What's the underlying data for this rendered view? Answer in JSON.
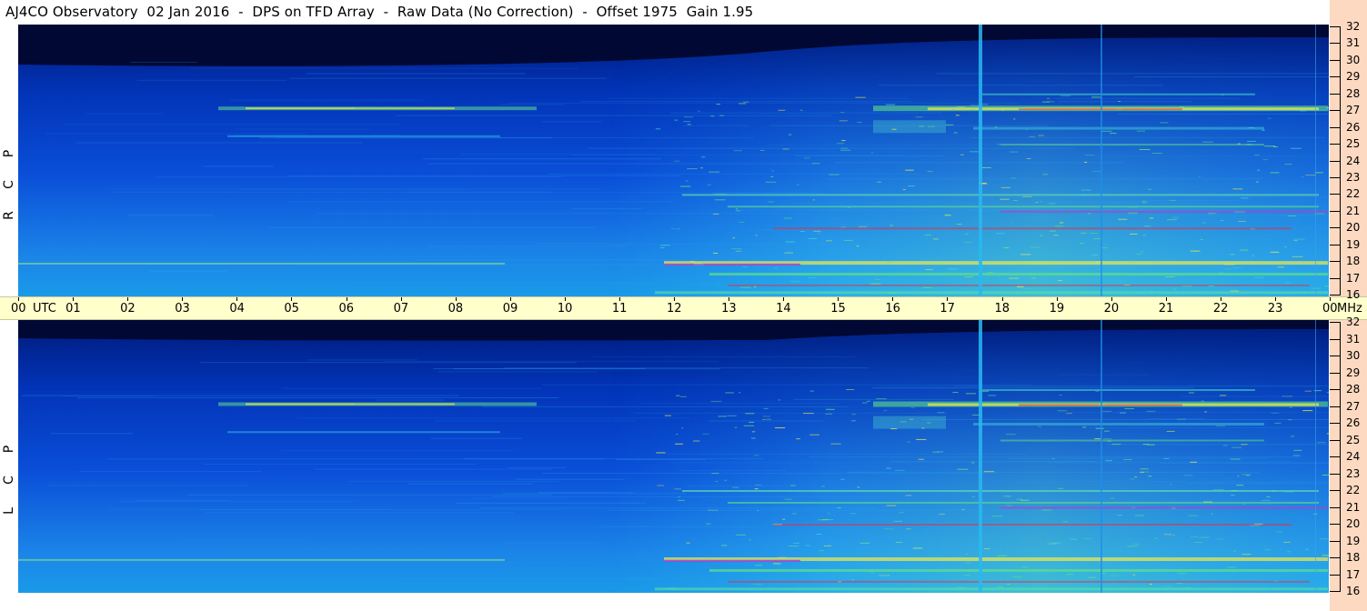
{
  "title": "AJ4CO Observatory  02 Jan 2016  -  DPS on TFD Array  -  Raw Data (No Correction)  -  Offset 1975  Gain 1.95",
  "panels": [
    {
      "id": "rcp",
      "label_letters": [
        "P",
        "C",
        "R"
      ]
    },
    {
      "id": "lcp",
      "label_letters": [
        "P",
        "C",
        "L"
      ]
    }
  ],
  "time_axis": {
    "labels": [
      "00",
      "UTC",
      "01",
      "02",
      "03",
      "04",
      "05",
      "06",
      "07",
      "08",
      "09",
      "10",
      "11",
      "12",
      "13",
      "14",
      "15",
      "16",
      "17",
      "18",
      "19",
      "20",
      "21",
      "22",
      "23",
      "00",
      "MHz"
    ]
  },
  "freq_axis": {
    "labels": [
      "32",
      "31",
      "30",
      "29",
      "28",
      "27",
      "26",
      "25",
      "24",
      "23",
      "22",
      "21",
      "20",
      "19",
      "18",
      "17",
      "16"
    ]
  },
  "colors": {
    "deep": "#000833",
    "dark_blue": "#001a7a",
    "mid_blue": "#0a4ed8",
    "cyan": "#23b6f0",
    "green": "#5fe08a",
    "yellow": "#f3e94a",
    "red": "#e0304e",
    "magenta": "#b040c8",
    "axis_bg": "#ffffcc",
    "strip_bg": "#fcd9c0"
  }
}
